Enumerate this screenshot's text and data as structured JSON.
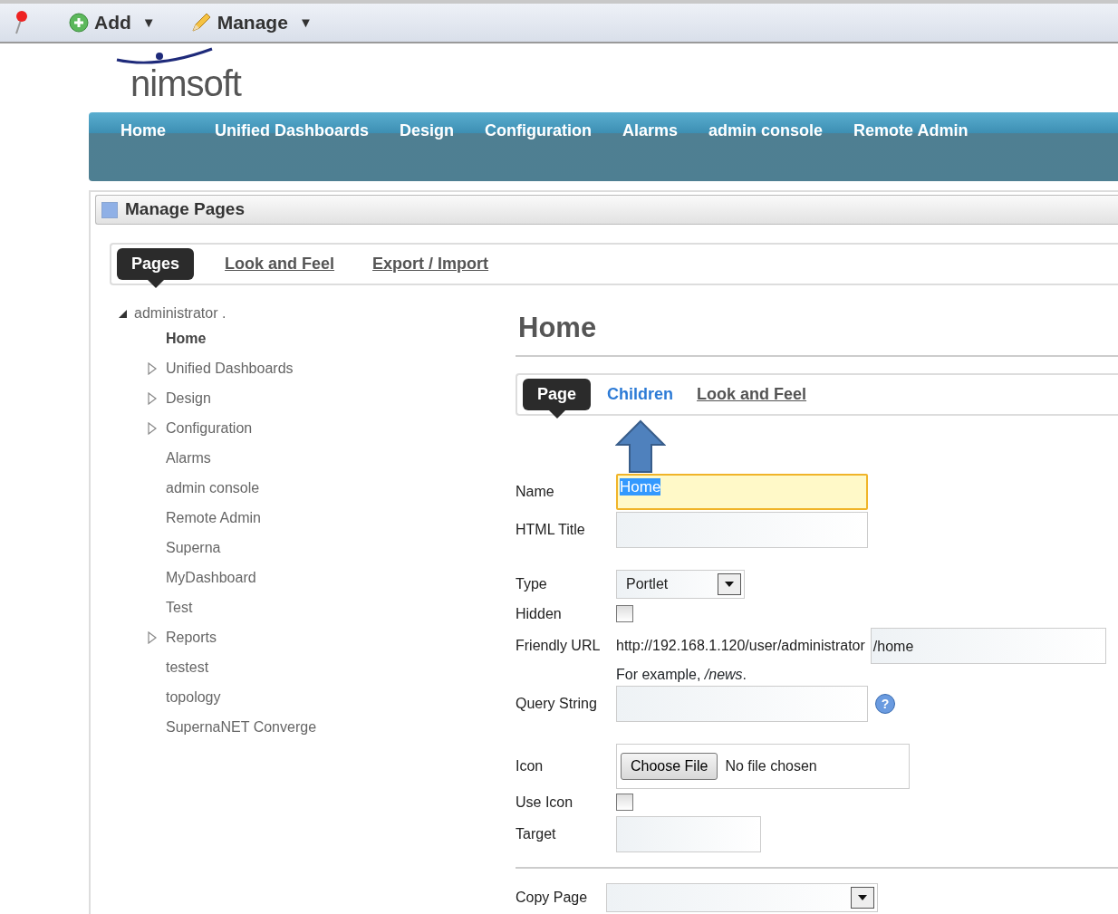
{
  "toolbar": {
    "items": [
      {
        "kind": "pin"
      },
      {
        "kind": "add",
        "label": "Add",
        "caret": "▼"
      },
      {
        "kind": "edit",
        "label": "Manage",
        "caret": "▼"
      }
    ]
  },
  "logo": {
    "text": "nimsoft"
  },
  "nav": {
    "items": [
      "Home",
      "Unified Dashboards",
      "Design",
      "Configuration",
      "Alarms",
      "admin console",
      "Remote Admin"
    ]
  },
  "panel": {
    "title": "Manage Pages"
  },
  "tabs": [
    {
      "label": "Pages",
      "selected": true
    },
    {
      "label": "Look and Feel",
      "selected": false
    },
    {
      "label": "Export / Import",
      "selected": false
    }
  ],
  "tree": {
    "label": "administrator .",
    "expanded": true,
    "children": [
      {
        "label": "Home",
        "selected": true,
        "kind": "page"
      },
      {
        "label": "Unified Dashboards",
        "selected": false,
        "kind": "folder"
      },
      {
        "label": "Design",
        "selected": false,
        "kind": "folder"
      },
      {
        "label": "Configuration",
        "selected": false,
        "kind": "folder"
      },
      {
        "label": "Alarms",
        "selected": false,
        "kind": "page"
      },
      {
        "label": "admin console",
        "selected": false,
        "kind": "page"
      },
      {
        "label": "Remote Admin",
        "selected": false,
        "kind": "page"
      },
      {
        "label": "Superna",
        "selected": false,
        "kind": "page"
      },
      {
        "label": "MyDashboard",
        "selected": false,
        "kind": "page"
      },
      {
        "label": "Test",
        "selected": false,
        "kind": "page"
      },
      {
        "label": "Reports",
        "selected": false,
        "kind": "folder"
      },
      {
        "label": "testest",
        "selected": false,
        "kind": "page"
      },
      {
        "label": "topology",
        "selected": false,
        "kind": "page"
      },
      {
        "label": "SupernaNET Converge",
        "selected": false,
        "kind": "page"
      }
    ]
  },
  "page": {
    "title": "Home",
    "tabs": [
      {
        "label": "Page",
        "selected": true,
        "highlighted": false
      },
      {
        "label": "Children",
        "selected": false,
        "highlighted": true
      },
      {
        "label": "Look and Feel",
        "selected": false,
        "highlighted": false
      }
    ],
    "fields": [
      {
        "kind": "text",
        "label": "Name",
        "value": "Home",
        "focused": true
      },
      {
        "kind": "text",
        "label": "HTML Title",
        "focused": false
      },
      {
        "kind": "select",
        "label": "Type",
        "value": "Portlet"
      },
      {
        "kind": "checkbox",
        "label": "Hidden",
        "checked": false
      },
      {
        "kind": "url",
        "label": "Friendly URL",
        "prefix": "http://192.168.1.120/user/administrator",
        "value": "/home",
        "hint": "For example, */news*."
      },
      {
        "kind": "text",
        "label": "Query String",
        "focused": false,
        "help": "?"
      },
      {
        "kind": "file",
        "label": "Icon",
        "button": "Choose File",
        "status": "No file chosen"
      },
      {
        "kind": "checkbox",
        "label": "Use Icon",
        "checked": false
      },
      {
        "kind": "short",
        "label": "Target"
      },
      {
        "kind": "rule"
      },
      {
        "kind": "select",
        "label": "Copy Page",
        "wide": true
      }
    ]
  }
}
